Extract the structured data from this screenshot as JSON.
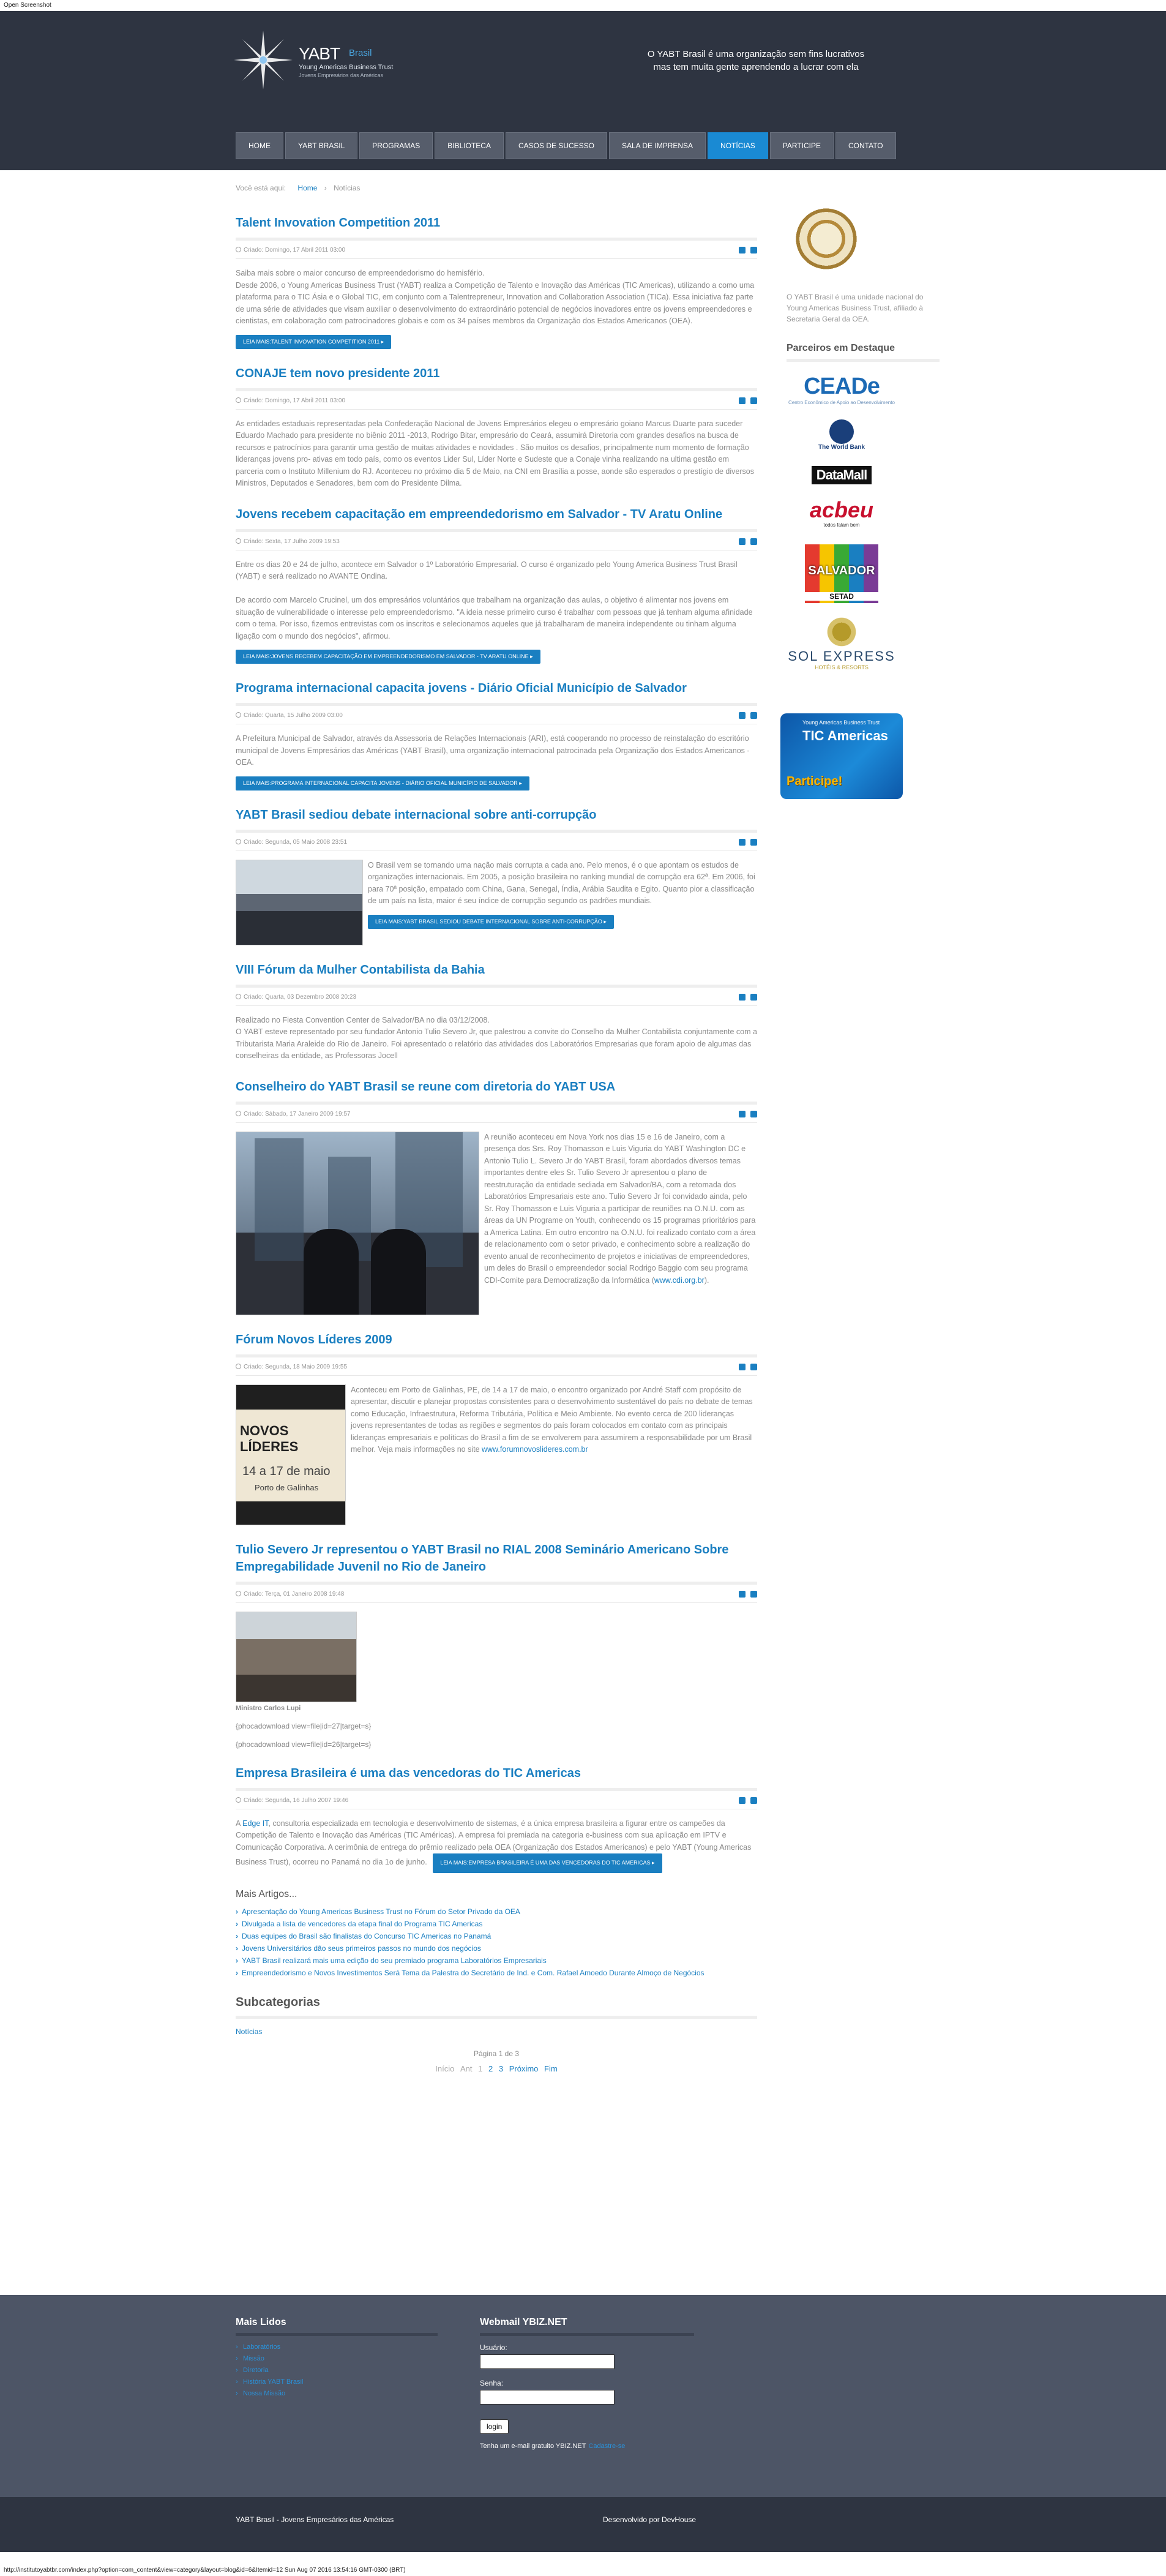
{
  "window": {
    "top_label": "Open Screenshot",
    "status_url": "http://institutoyabtbr.com/index.php?option=com_content&view=category&layout=blog&id=6&Itemid=12 Sun Aug 07 2016 13:54:16 GMT-0300 (BRT)"
  },
  "header": {
    "logo_title": "YABT",
    "logo_brasil": "Brasil",
    "logo_sub1": "Young Americas Business Trust",
    "logo_sub2": "Jovens Empresários das Américas",
    "tagline_line1": "O YABT Brasil é uma organização sem fins lucrativos",
    "tagline_line2": "mas tem muita gente aprendendo a lucrar com ela"
  },
  "nav": [
    "HOME",
    "YABT BRASIL",
    "PROGRAMAS",
    "BIBLIOTECA",
    "CASOS DE SUCESSO",
    "SALA DE IMPRENSA",
    "NOTÍCIAS",
    "PARTICIPE",
    "CONTATO"
  ],
  "breadcrumb": {
    "prefix": "Você está aqui:",
    "home": "Home",
    "current": "Notícias"
  },
  "articles": [
    {
      "title": "Talent Invovation Competition 2011",
      "date": "Criado: Domingo, 17 Abril 2011 03:00",
      "body": "Saiba mais sobre o maior concurso de empreendedorismo do hemisfério.\nDesde 2006, o Young Americas Business Trust (YABT) realiza a Competição de Talento e Inovação das Américas (TIC Americas), utilizando a como uma plataforma para o TIC Ásia e o Global TIC, em conjunto com a Talentrepreneur, Innovation and Collaboration Association (TICa). Essa iniciativa faz parte de uma série de atividades que visam auxiliar o desenvolvimento do extraordinário potencial de negócios inovadores entre os jovens empreendedores e cientistas, em colaboração com patrocinadores globais e com os 34 países membros da Organização dos Estados Americanos (OEA).",
      "readmore": "LEIA MAIS:TALENT INVOVATION COMPETITION 2011 ▸"
    },
    {
      "title": "CONAJE tem novo presidente 2011",
      "date": "Criado: Domingo, 17 Abril 2011 03:00",
      "body": "As entidades estaduais representadas pela Confederação Nacional de Jovens Empresários elegeu o empresário goiano Marcus Duarte para suceder Eduardo Machado para presidente no biênio 2011 -2013, Rodrigo Bitar, empresário do Ceará, assumirá Diretoria com grandes desafios na busca de recursos e patrocínios para garantir uma gestão de muitas atividades e novidades . São muitos os desafios, principalmente num momento de formação lideranças jovens pro- ativas em todo país, como os eventos Lider Sul, Líder Norte e Sudeste que a Conaje vinha realizando na ultima gestão em parceria com o Instituto Millenium do RJ. Aconteceu no próximo dia 5 de Maio, na CNI em Brasília a posse, aonde são esperados o prestígio de diversos Ministros, Deputados e Senadores, bem com do Presidente Dilma."
    },
    {
      "title": "Jovens recebem capacitação em empreendedorismo em Salvador - TV Aratu Online",
      "date": "Criado: Sexta, 17 Julho 2009 19:53",
      "body": "Entre os dias 20 e 24 de julho, acontece em Salvador o 1º Laboratório Empresarial. O curso é organizado pelo Young America Business Trust Brasil (YABT) e será realizado no AVANTE Ondina.\n\nDe acordo com Marcelo Crucinel, um dos empresários voluntários que trabalham na organização das aulas, o objetivo é alimentar nos jovens em situação de vulnerabilidade o interesse pelo empreendedorismo. \"A ideia nesse primeiro curso é trabalhar com pessoas que já tenham alguma afinidade com o tema. Por isso, fizemos entrevistas com os inscritos e selecionamos aqueles que já trabalharam de maneira independente ou tinham alguma ligação com o mundo dos negócios\", afirmou.",
      "readmore": "LEIA MAIS:JOVENS RECEBEM CAPACITAÇÃO EM EMPREENDEDORISMO EM SALVADOR - TV ARATU ONLINE ▸"
    },
    {
      "title": "Programa internacional capacita jovens - Diário Oficial Município de Salvador",
      "date": "Criado: Quarta, 15 Julho 2009 03:00",
      "body": "A Prefeitura Municipal de Salvador, através da Assessoria de Relações Internacionais (ARI), está cooperando no processo de reinstalação do escritório municipal de Jovens Empresários das Américas (YABT Brasil), uma organização internacional patrocinada pela Organização dos Estados Americanos - OEA.",
      "readmore": "LEIA MAIS:PROGRAMA INTERNACIONAL CAPACITA JOVENS - DIÁRIO OFICIAL MUNICÍPIO DE SALVADOR ▸"
    },
    {
      "title": "YABT Brasil sediou debate internacional sobre anti-corrupção",
      "date": "Criado: Segunda, 05 Maio 2008 23:51",
      "body": "O Brasil vem se tornando uma nação mais corrupta a cada ano. Pelo menos, é o que apontam os estudos de organizações internacionais. Em 2005, a posição brasileira no ranking mundial de corrupção era 62ª. Em 2006, foi para 70ª posição, empatado com China, Gana, Senegal, Índia, Arábia Saudita e Egito. Quanto pior a classificação de um país na lista, maior é seu índice de corrupção segundo os padrões mundiais.",
      "readmore": "LEIA MAIS:YABT BRASIL SEDIOU DEBATE INTERNACIONAL SOBRE ANTI-CORRUPÇÃO ▸"
    },
    {
      "title": "VIII Fórum da Mulher Contabilista da Bahia",
      "date": "Criado: Quarta, 03 Dezembro 2008 20:23",
      "body": "Realizado no Fiesta Convention Center de Salvador/BA no dia 03/12/2008.\nO YABT esteve representado por seu fundador Antonio Tulio Severo Jr, que palestrou a convite do Conselho da Mulher Contabilista conjuntamente com a Tributarista Maria Araleide do Rio de Janeiro. Foi apresentado o relatório das atividades dos Laboratórios Empresarias que foram apoio de algumas das conselheiras da entidade, as Professoras Jocell"
    },
    {
      "title": "Conselheiro do YABT Brasil se reune com diretoria do YABT USA",
      "date": "Criado: Sábado, 17 Janeiro 2009 19:57",
      "body": "A reunião aconteceu em Nova York nos dias 15 e 16 de Janeiro, com a presença dos Srs. Roy Thomasson e Luis Viguria do YABT Washington DC e Antonio Tulio L. Severo Jr do YABT Brasil, foram abordados diversos temas importantes dentre eles Sr. Tulio Severo Jr apresentou o plano de reestruturação da entidade sediada em Salvador/BA, com a retomada dos Laboratórios Empresariais este ano. Tulio Severo Jr foi convidado ainda, pelo Sr. Roy Thomasson e Luis Viguria a participar de reuniões na O.N.U. com as áreas da UN Programe on Youth, conhecendo os 15 programas prioritários para a America Latina. Em outro encontro na O.N.U. foi realizado contato com a área de relacionamento com o setor privado, e conhecimento sobre a realização do evento anual de reconhecimento de projetos e iniciativas de empreendedores, um deles do Brasil o empreendedor social Rodrigo Baggio com seu programa CDI-Comite para Democratização da Informática (",
      "link": "www.cdi.org.br",
      "tail": ")."
    },
    {
      "title": "Fórum Novos Líderes 2009",
      "date": "Criado: Segunda, 18 Maio 2009 19:55",
      "body": "Aconteceu em Porto de Galinhas, PE, de 14 a 17 de maio, o encontro organizado por André Staff com propósito de apresentar, discutir e planejar propostas consistentes para o desenvolvimento sustentável do país no debate de temas como Educação, Infraestrutura, Reforma Tributária, Política e Meio Ambiente. No evento cerca de 200 lideranças jovens representantes de todas as regiões e segmentos do país foram colocados em contato com as principais lideranças empresariais e políticas do Brasil a fim de se envolverem para assumirem a responsabilidade por um Brasil melhor. Veja mais informações no site ",
      "link": "www.forumnovoslideres.com.br",
      "photo_t1": "NOVOS LÍDERES",
      "photo_t2": "14 a 17 de maio",
      "photo_t3": "Porto de Galinhas"
    },
    {
      "title": "Tulio Severo Jr representou o YABT Brasil no RIAL 2008 Seminário Americano Sobre Empregabilidade Juvenil no Rio de Janeiro",
      "date": "Criado: Terça, 01 Janeiro 2008 19:48",
      "caption": "Ministro Carlos Lupi",
      "line1": "{phocadownload view=file|id=27|target=s}",
      "line2": "{phocadownload view=file|id=26|target=s}"
    },
    {
      "title": "Empresa Brasileira é uma das vencedoras do TIC Americas",
      "date": "Criado: Segunda, 16 Julho 2007 19:46",
      "body_pre": "A ",
      "body_link": "Edge IT",
      "body": ", consultoria especializada em tecnologia e desenvolvimento de sistemas, é a única empresa brasileira a figurar entre os campeões da Competição de Talento e Inovação das Américas (TIC Américas). A empresa foi premiada na categoria e-business com sua aplicação em IPTV e Comunicação Corporativa. A cerimônia de entrega do prêmio realizado pela OEA (Organização dos Estados Americanos) e pelo YABT (Young Americas Business Trust), ocorreu no Panamá no dia 1o de junho.",
      "readmore": "LEIA MAIS:EMPRESA BRASILEIRA É UMA DAS VENCEDORAS DO TIC AMERICAS ▸"
    }
  ],
  "more": {
    "title": "Mais Artigos...",
    "items": [
      "Apresentação do Young Americas Business Trust no Fórum do Setor Privado da OEA",
      "Divulgada a lista de vencedores da etapa final do Programa TIC Americas",
      "Duas equipes do Brasil são finalistas do Concurso TIC Americas no Panamá",
      "Jovens Universitários dão seus primeiros passos no mundo dos negócios",
      "YABT Brasil realizará mais uma edição do seu premiado programa Laboratórios Empresariais",
      "Empreendedorismo e Novos Investimentos Será Tema da Palestra do Secretário de Ind. e Com. Rafael Amoedo Durante Almoço de Negócios"
    ]
  },
  "subcategories": {
    "title": "Subcategorias",
    "link": "Notícias"
  },
  "pagination": {
    "label": "Página 1 de 3",
    "inicio": "Início",
    "ant": "Ant",
    "p1": "1",
    "p2": "2",
    "p3": "3",
    "next": "Próximo",
    "end": "Fim"
  },
  "sidebar": {
    "about": "O YABT Brasil é uma unidade nacional do Young Americas Business Trust, afiliado à Secretaria Geral da OEA.",
    "partners_title": "Parceiros em Destaque",
    "ceade_name": "CEADe",
    "ceade_sub": "Centro Econômico de Apoio ao Desenvolvimento",
    "wb": "The World Bank",
    "datamall": "DataMall",
    "acbeu": "acbeu",
    "acbeu_sub": "todos falam bem",
    "salvador": "SALVADOR",
    "setad": "SETAD",
    "sol_name": "SOL EXPRESS",
    "sol_sub": "HOTÉIS & RESORTS",
    "tic_l1": "Young Americas Business Trust",
    "tic_l2": "TIC Americas",
    "tic_l3": "Participe!"
  },
  "bottom": {
    "maislidos_title": "Mais Lidos",
    "maislidos": [
      "Laboratórios",
      "Missão",
      "Diretoria",
      "História YABT Brasil",
      "Nossa Missão"
    ],
    "webmail_title": "Webmail YBIZ.NET",
    "user_label": "Usuário:",
    "pass_label": "Senha:",
    "login": "login",
    "trial": "Tenha um e-mail gratuito YBIZ.NET",
    "trial_link": "Cadastre-se"
  },
  "footer": {
    "left": "YABT Brasil - Jovens Empresários das Américas",
    "right": "Desenvolvido por DevHouse"
  }
}
